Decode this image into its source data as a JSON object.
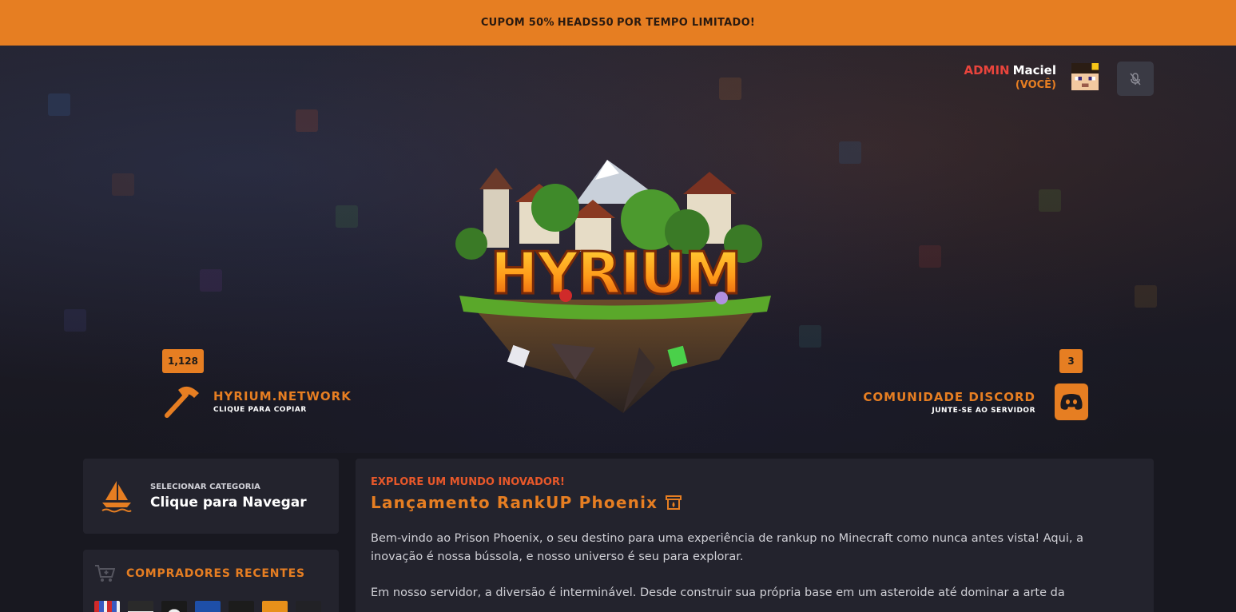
{
  "banner": {
    "prefix": "CUPOM 50%",
    "code": "HEADS50",
    "suffix": "POR TEMPO LIMITADO!"
  },
  "user": {
    "role": "ADMIN",
    "name": "Maciel",
    "you_label": "(VOCÊ)"
  },
  "logo_text": "HYRIUM",
  "server": {
    "players_online": "1,128",
    "address": "HYRIUM.NETWORK",
    "action": "CLIQUE PARA COPIAR"
  },
  "discord": {
    "count": "3",
    "title": "COMUNIDADE DISCORD",
    "action": "JUNTE-SE AO SERVIDOR"
  },
  "category": {
    "subtitle": "SELECIONAR CATEGORIA",
    "title": "Clique para Navegar"
  },
  "buyers": {
    "title": "COMPRADORES RECENTES"
  },
  "article": {
    "kicker": "EXPLORE UM MUNDO INOVADOR!",
    "title": "Lançamento RankUP Phoenix",
    "paragraphs": [
      "Bem-vindo ao Prison Phoenix, o seu destino para uma experiência de rankup no Minecraft como nunca antes vista! Aqui, a inovação é nossa bússola, e nosso universo é seu para explorar.",
      "Em nosso servidor, a diversão é interminável. Desde construir sua própria base em um asteroide até dominar a arte da"
    ]
  },
  "colors": {
    "accent": "#e67e22",
    "admin": "#e8443c",
    "panel": "#23232d",
    "background": "#181820"
  },
  "icons": [
    "mic-off-icon",
    "axe-icon",
    "discord-icon",
    "sailboat-icon",
    "cart-icon"
  ]
}
